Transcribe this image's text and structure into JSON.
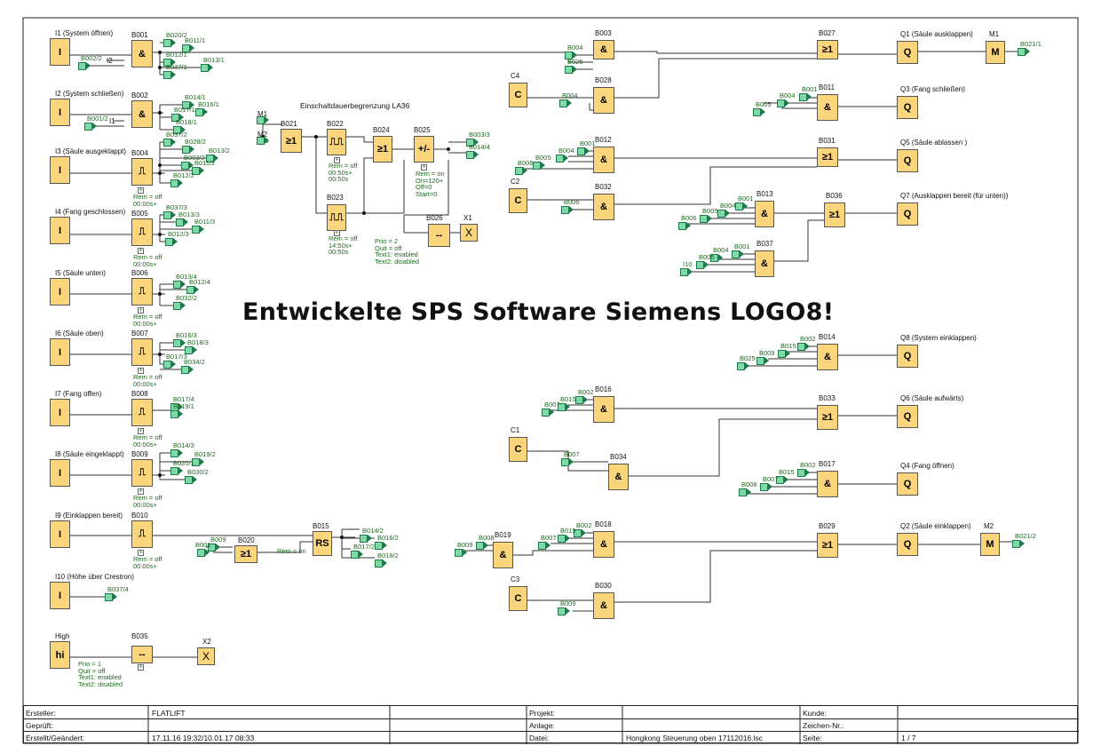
{
  "title": "Entwickelte SPS Software Siemens LOGO8!",
  "section_label": "Einschaltdauerbegrenzung LA36",
  "inputs": [
    {
      "id": "I1",
      "label": "I1 (System öffnen)",
      "symbol": "I"
    },
    {
      "id": "I2",
      "label": "I2 (System schließen)",
      "symbol": "I"
    },
    {
      "id": "I3",
      "label": "I3 (Säule ausgeklappt)",
      "symbol": "I"
    },
    {
      "id": "I4",
      "label": "I4 (Fang geschlossen)",
      "symbol": "I"
    },
    {
      "id": "I5",
      "label": "I5 (Säule unten)",
      "symbol": "I"
    },
    {
      "id": "I6",
      "label": "I6 (Säule oben)",
      "symbol": "I"
    },
    {
      "id": "I7",
      "label": "I7 (Fang offen)",
      "symbol": "I"
    },
    {
      "id": "I8",
      "label": "I8 (Säule eingeklappt)",
      "symbol": "I"
    },
    {
      "id": "I9",
      "label": "I9 (Einklappen bereit)",
      "symbol": "I"
    },
    {
      "id": "I10",
      "label": "I10 (Höhe über Crestron)",
      "symbol": "I"
    },
    {
      "id": "High",
      "label": "High",
      "symbol": "hi"
    }
  ],
  "input_blocks": [
    {
      "name": "B001",
      "symbol": "&",
      "links": [
        "B020/2",
        "B011/1",
        "B012/1",
        "B013/1",
        "B037/1"
      ],
      "ins": [
        "B002/2",
        "I2"
      ],
      "params": []
    },
    {
      "name": "B002",
      "symbol": "&",
      "links": [
        "B014/1",
        "B016/1",
        "B017/1",
        "B018/1"
      ],
      "ins": [
        "B001/2",
        "I1"
      ],
      "params": []
    },
    {
      "name": "B004",
      "symbol": "⎍",
      "links": [
        "B037/2",
        "B028/2",
        "B013/2",
        "B003/2",
        "B011/2",
        "B012/2"
      ],
      "ins": [],
      "params": [
        "Rem = off",
        "00:00s+"
      ]
    },
    {
      "name": "B005",
      "symbol": "⎍",
      "links": [
        "B037/3",
        "B013/3",
        "B011/3",
        "B012/3"
      ],
      "ins": [],
      "params": [
        "Rem = off",
        "00:00s+"
      ]
    },
    {
      "name": "B006",
      "symbol": "⎍",
      "links": [
        "B013/4",
        "B012/4",
        "B032/2"
      ],
      "ins": [],
      "params": [
        "Rem = off",
        "00:00s+"
      ]
    },
    {
      "name": "B007",
      "symbol": "⎍",
      "links": [
        "B016/3",
        "B018/3",
        "B017/3",
        "B034/2"
      ],
      "ins": [],
      "params": [
        "Rem = off",
        "00:00s+"
      ]
    },
    {
      "name": "B008",
      "symbol": "⎍",
      "links": [
        "B017/4",
        "B019/1"
      ],
      "ins": [],
      "params": [
        "Rem = off",
        "00:00s+"
      ]
    },
    {
      "name": "B009",
      "symbol": "⎍",
      "links": [
        "B014/3",
        "B019/2",
        "B020/1",
        "B030/2"
      ],
      "ins": [],
      "params": [
        "Rem = off",
        "00:00s+"
      ]
    },
    {
      "name": "B010",
      "symbol": "⎍",
      "links": [],
      "ins": [],
      "params": [
        "Rem = off",
        "00:00s+"
      ]
    },
    {
      "name": "B035",
      "symbol": "--",
      "links": [],
      "ins": [],
      "params": [
        "Prio = 1",
        "Quit = off",
        "Text1: enabled",
        "Text2: disabled"
      ]
    }
  ],
  "b037_4": "B037/4",
  "x2": "X2",
  "mid_blocks": {
    "m1": "M1",
    "m2": "M2",
    "b021": {
      "name": "B021",
      "symbol": "≥1"
    },
    "b022": {
      "name": "B022",
      "params": [
        "Rem = off",
        "00:50s+",
        "00:50s"
      ]
    },
    "b023": {
      "name": "B023",
      "params": [
        "Rem = off",
        "14:50s+",
        "00:50s"
      ]
    },
    "b024": {
      "name": "B024",
      "symbol": "≥1"
    },
    "b025": {
      "name": "B025",
      "symbol": "+/-",
      "params": [
        "Rem = on",
        "On=120+",
        "Off=0",
        "Start=0"
      ],
      "links": [
        "B003/3",
        "B014/4"
      ]
    },
    "b026": {
      "name": "B026",
      "params": [
        "Prio = 2",
        "Quit = off",
        "Text1: enabled",
        "Text2: disabled"
      ]
    },
    "x1": "X1",
    "b015": {
      "name": "B015",
      "symbol": "RS",
      "param": "Rem = on",
      "links": [
        "B014/2",
        "B016/2",
        "B017/2",
        "B018/2"
      ]
    },
    "b020": {
      "name": "B020",
      "symbol": "≥1",
      "ins": [
        "B009",
        "B001"
      ]
    }
  },
  "right_blocks": [
    {
      "name": "B003",
      "symbol": "&",
      "ins": [
        "B004",
        "B025"
      ]
    },
    {
      "name": "B028",
      "symbol": "&",
      "ins": [
        "B004"
      ]
    },
    {
      "name": "B012",
      "symbol": "&",
      "ins": [
        "B001",
        "B004",
        "B005",
        "B006"
      ]
    },
    {
      "name": "B032",
      "symbol": "&",
      "ins": [
        "B006"
      ]
    },
    {
      "name": "B027",
      "symbol": "≥1",
      "ins": []
    },
    {
      "name": "B011",
      "symbol": "&",
      "ins": [
        "B001",
        "B004",
        "B005"
      ]
    },
    {
      "name": "B031",
      "symbol": "≥1",
      "ins": []
    },
    {
      "name": "B013",
      "symbol": "&",
      "ins": [
        "B001",
        "B004",
        "B005",
        "B006"
      ]
    },
    {
      "name": "B036",
      "symbol": "≥1",
      "ins": []
    },
    {
      "name": "B037",
      "symbol": "&",
      "ins": [
        "B001",
        "B004",
        "B005",
        "I10"
      ]
    },
    {
      "name": "B014",
      "symbol": "&",
      "ins": [
        "B002",
        "B015",
        "B009",
        "B025"
      ]
    },
    {
      "name": "B016",
      "symbol": "&",
      "ins": [
        "B002",
        "B015",
        "B007"
      ]
    },
    {
      "name": "B034",
      "symbol": "&",
      "ins": [
        "B007"
      ]
    },
    {
      "name": "B033",
      "symbol": "≥1",
      "ins": []
    },
    {
      "name": "B017",
      "symbol": "&",
      "ins": [
        "B002",
        "B015",
        "B007",
        "B008"
      ]
    },
    {
      "name": "B019",
      "symbol": "&",
      "ins": [
        "B008",
        "B009"
      ]
    },
    {
      "name": "B018",
      "symbol": "&",
      "ins": [
        "B002",
        "B015",
        "B007"
      ]
    },
    {
      "name": "B029",
      "symbol": "≥1",
      "ins": []
    },
    {
      "name": "B030",
      "symbol": "&",
      "ins": [
        "B009"
      ]
    }
  ],
  "constants": [
    "C4",
    "C2",
    "C1",
    "C3"
  ],
  "outputs": [
    {
      "name": "Q1 (Säule ausklappen)",
      "symbol": "Q"
    },
    {
      "name": "Q3 (Fang schließen)",
      "symbol": "Q"
    },
    {
      "name": "Q5 (Säule ablassen )",
      "symbol": "Q"
    },
    {
      "name": "Q7 (Ausklappen bereit (für unten))",
      "symbol": "Q"
    },
    {
      "name": "Q8 (System einklappen)",
      "symbol": "Q"
    },
    {
      "name": "Q6 (Säule aufwärts)",
      "symbol": "Q"
    },
    {
      "name": "Q4 (Fang öffnen)",
      "symbol": "Q"
    },
    {
      "name": "Q2 (Säule einklappen)",
      "symbol": "Q"
    }
  ],
  "motors": [
    {
      "name": "M1",
      "symbol": "M",
      "link": "B021/1"
    },
    {
      "name": "M2",
      "symbol": "M",
      "link": "B021/2"
    }
  ],
  "title_block": {
    "ersteller_k": "Ersteller:",
    "ersteller_v": "FLATLIFT",
    "geprueft_k": "Geprüft:",
    "erstellt_k": "Erstellt/Geändert:",
    "erstellt_v": "17.11.16 19:32/10.01.17 08:33",
    "projekt_k": "Projekt:",
    "anlage_k": "Anlage:",
    "datei_k": "Datei:",
    "datei_v": "Hongkong Steuerung oben 17112016.lsc",
    "kunde_k": "Kunde:",
    "zeichen_k": "Zeichen-Nr.:",
    "seite_k": "Seite:",
    "seite_v": "1 / 7"
  }
}
